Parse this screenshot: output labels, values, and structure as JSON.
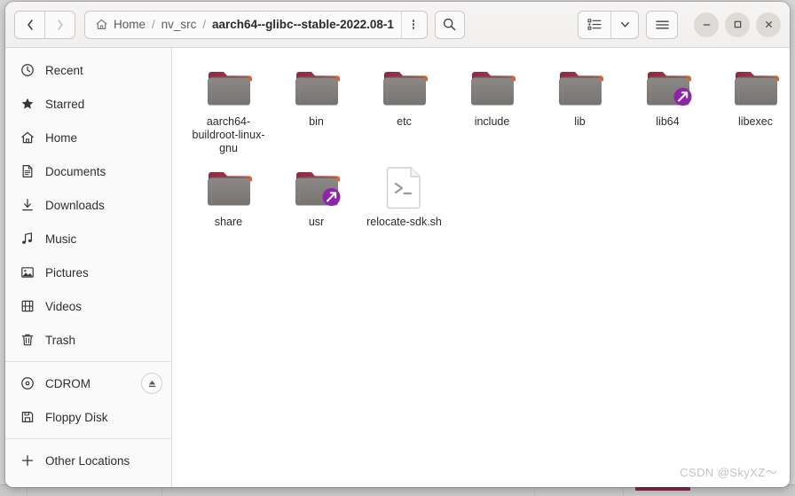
{
  "window": {
    "controls": {
      "minimize_label": "−",
      "maximize_label": "□",
      "close_label": "×"
    }
  },
  "headerbar": {
    "back_label": "‹",
    "forward_label": "›",
    "breadcrumb": {
      "home_label": "Home",
      "separator": "/",
      "items": [
        {
          "label": "nv_src",
          "current": false
        },
        {
          "label": "aarch64--glibc--stable-2022.08-1",
          "current": true
        }
      ]
    },
    "path_menu_name": "path-options",
    "search_name": "search",
    "view_list_name": "list-view",
    "view_chevron_name": "view-options",
    "menu_name": "main-menu"
  },
  "sidebar": {
    "groups": [
      {
        "items": [
          {
            "label": "Recent",
            "icon": "clock-icon"
          },
          {
            "label": "Starred",
            "icon": "star-icon"
          },
          {
            "label": "Home",
            "icon": "home-icon"
          },
          {
            "label": "Documents",
            "icon": "document-icon"
          },
          {
            "label": "Downloads",
            "icon": "download-icon"
          },
          {
            "label": "Music",
            "icon": "music-note-icon"
          },
          {
            "label": "Pictures",
            "icon": "picture-icon"
          },
          {
            "label": "Videos",
            "icon": "film-icon"
          },
          {
            "label": "Trash",
            "icon": "trash-icon"
          }
        ]
      },
      {
        "items": [
          {
            "label": "CDROM",
            "icon": "disc-icon",
            "eject": true
          },
          {
            "label": "Floppy Disk",
            "icon": "floppy-icon"
          }
        ]
      },
      {
        "items": [
          {
            "label": "Other Locations",
            "icon": "plus-icon"
          }
        ]
      }
    ]
  },
  "content": {
    "files": [
      {
        "name": "aarch64-buildroot-linux-gnu",
        "type": "folder",
        "symlink": false
      },
      {
        "name": "bin",
        "type": "folder",
        "symlink": false
      },
      {
        "name": "etc",
        "type": "folder",
        "symlink": false
      },
      {
        "name": "include",
        "type": "folder",
        "symlink": false
      },
      {
        "name": "lib",
        "type": "folder",
        "symlink": false
      },
      {
        "name": "lib64",
        "type": "folder",
        "symlink": true
      },
      {
        "name": "libexec",
        "type": "folder",
        "symlink": false
      },
      {
        "name": "share",
        "type": "folder",
        "symlink": false
      },
      {
        "name": "usr",
        "type": "folder",
        "symlink": true
      },
      {
        "name": "relocate-sdk.sh",
        "type": "script",
        "symlink": false
      }
    ]
  },
  "watermark": {
    "text": "CSDN @SkyXZ～"
  },
  "colors": {
    "folder_body": "#7e7b79",
    "folder_tab_start": "#8c2846",
    "folder_tab_end": "#e8622a",
    "symlink_badge": "#8e24aa",
    "headerbar_bg": "#f2f1ef",
    "sidebar_bg": "#fafafa"
  }
}
